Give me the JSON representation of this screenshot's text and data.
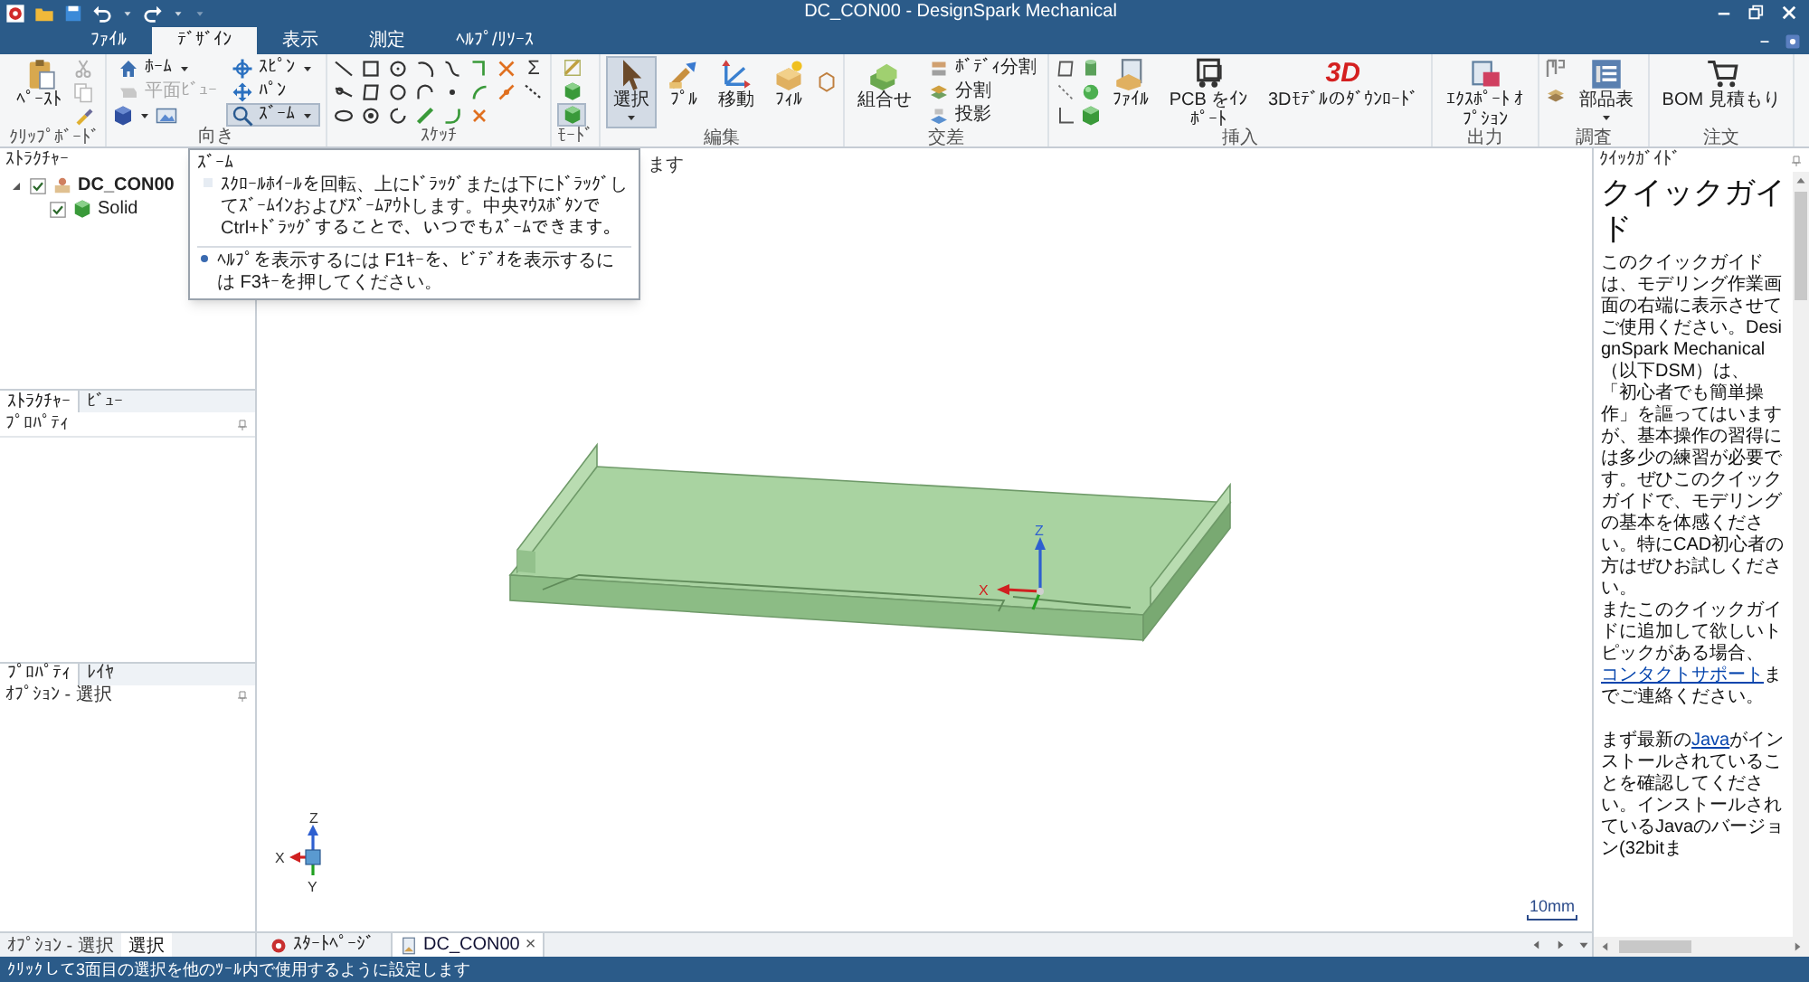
{
  "window": {
    "title": "DC_CON00 - DesignSpark Mechanical"
  },
  "menu_tabs": [
    {
      "label": "ﾌｧｲﾙ",
      "selected": false
    },
    {
      "label": "ﾃﾞｻﾞｲﾝ",
      "selected": true
    },
    {
      "label": "表示",
      "selected": false
    },
    {
      "label": "測定",
      "selected": false
    },
    {
      "label": "ﾍﾙﾌﾟ/ﾘｿｰｽ",
      "selected": false
    }
  ],
  "ribbon_groups": [
    {
      "label": "ｸﾘｯﾌﾟﾎﾞｰﾄﾞ",
      "buttons": [
        {
          "label": "ﾍﾟｰｽﾄ"
        }
      ]
    },
    {
      "label": "向き",
      "buttons": [
        {
          "label": "ﾎｰﾑ",
          "selected": false,
          "disabled": false
        },
        {
          "label": "平面ﾋﾞｭｰ",
          "selected": false,
          "disabled": true
        },
        {
          "label": "ｽﾋﾟﾝ",
          "selected": false,
          "disabled": false
        },
        {
          "label": "ﾊﾟﾝ",
          "selected": false,
          "disabled": false
        },
        {
          "label": "ｽﾞｰﾑ",
          "selected": true,
          "disabled": false
        }
      ]
    },
    {
      "label": "ｽｹｯﾁ",
      "symbol": "Σ"
    },
    {
      "label": "ﾓｰﾄﾞ",
      "modes": [
        {
          "selected": false
        },
        {
          "selected": false
        },
        {
          "selected": true
        }
      ]
    },
    {
      "label": "編集",
      "buttons": [
        {
          "label": "選択",
          "selected": true
        },
        {
          "label": "ﾌﾟﾙ",
          "selected": false
        },
        {
          "label": "移動",
          "selected": false
        },
        {
          "label": "ﾌｨﾙ",
          "selected": false
        }
      ]
    },
    {
      "label": "交差",
      "buttons": [
        {
          "label": "組合せ"
        },
        {
          "label": "ﾎﾞﾃﾞｨ分割"
        },
        {
          "label": "分割"
        },
        {
          "label": "投影"
        }
      ]
    },
    {
      "label": "挿入",
      "buttons": [
        {
          "label": "ﾌｧｲﾙ"
        },
        {
          "label": "PCB をｲﾝﾎﾟｰﾄ"
        },
        {
          "label": "3Dﾓﾃﾞﾙのﾀﾞｳﾝﾛｰﾄﾞ",
          "logo": "3D"
        }
      ]
    },
    {
      "label": "出力",
      "buttons": [
        {
          "label": "ｴｸｽﾎﾟｰﾄ ｵﾌﾟｼｮﾝ"
        }
      ]
    },
    {
      "label": "調査",
      "buttons": [
        {
          "label": "部品表"
        }
      ]
    },
    {
      "label": "注文",
      "buttons": [
        {
          "label": "BOM 見積もり"
        }
      ]
    }
  ],
  "structure_panel": {
    "title": "ｽﾄﾗｸﾁｬｰ",
    "tree": [
      {
        "label": "DC_CON00",
        "checked": true,
        "expanded": true,
        "children": [
          {
            "label": "Solid",
            "checked": true
          }
        ]
      }
    ],
    "tabs": [
      {
        "label": "ｽﾄﾗｸﾁｬｰ",
        "selected": true
      },
      {
        "label": "ﾋﾞｭｰ",
        "selected": false
      }
    ]
  },
  "properties_panel": {
    "title": "ﾌﾟﾛﾊﾟﾃｨ",
    "tabs": [
      {
        "label": "ﾌﾟﾛﾊﾟﾃｨ",
        "selected": true
      },
      {
        "label": "ﾚｲﾔ",
        "selected": false
      }
    ]
  },
  "options_panel": {
    "title": "ｵﾌﾟｼｮﾝ - 選択"
  },
  "bottom_left_tabs": [
    {
      "label": "ｵﾌﾟｼｮﾝ - 選択",
      "selected": false
    },
    {
      "label": "選択",
      "selected": true
    }
  ],
  "tooltip": {
    "title": "ｽﾞｰﾑ",
    "body": "ｽｸﾛｰﾙﾎｲｰﾙを回転、上にﾄﾞﾗｯｸﾞまたは下にﾄﾞﾗｯｸﾞしてｽﾞｰﾑｲﾝおよびｽﾞｰﾑｱｳﾄします。中央ﾏｳｽﾎﾞﾀﾝでCtrl+ﾄﾞﾗｯｸﾞすることで、いつでもｽﾞｰﾑできます。",
    "footer": "ﾍﾙﾌﾟを表示するには F1ｷｰを、ﾋﾞﾃﾞｵを表示するには F3ｷｰを押してください。"
  },
  "viewport": {
    "hint": "ます",
    "model_axes": [
      "Z",
      "X"
    ],
    "triad_axes": [
      "Z",
      "X",
      "Y"
    ],
    "scale": "10mm"
  },
  "document_tabs": [
    {
      "label": "ｽﾀｰﾄﾍﾟｰｼﾞ",
      "selected": false
    },
    {
      "label": "DC_CON00",
      "selected": true,
      "close": "×"
    }
  ],
  "quick_guide": {
    "title": "ｸｲｯｸｶﾞｲﾄﾞ",
    "heading": "クイックガイド",
    "sections": [
      [
        [
          {
            "text": "このクイックガイドは、モデリング作業画面の右端に表示させてご使用ください。DesignSpark Mechanical（以下DSM）は、「初心者でも簡単操作」を謳ってはいますが、基本操作の習得には多少の練習が必要です。ぜひこのクイックガイドで、モデリングの基本を体感ください。特にCAD初心者の方はぜひお試しください。"
          }
        ],
        [
          {
            "text": "またこのクイックガイドに追加して欲しいトピックがある場合、"
          },
          {
            "text": "コンタクトサポート",
            "kind": "link"
          },
          {
            "text": "までご連絡ください。"
          }
        ]
      ],
      [
        [
          {
            "text": "まず最新の"
          },
          {
            "text": "Java",
            "kind": "link"
          },
          {
            "text": "がインストールされていることを確認してください。インストールされているJavaのバージョン(32bitま"
          }
        ]
      ]
    ]
  },
  "status_bar": {
    "text": "ｸﾘｯｸして3面目の選択を他のﾂｰﾙ内で使用するように設定します"
  }
}
